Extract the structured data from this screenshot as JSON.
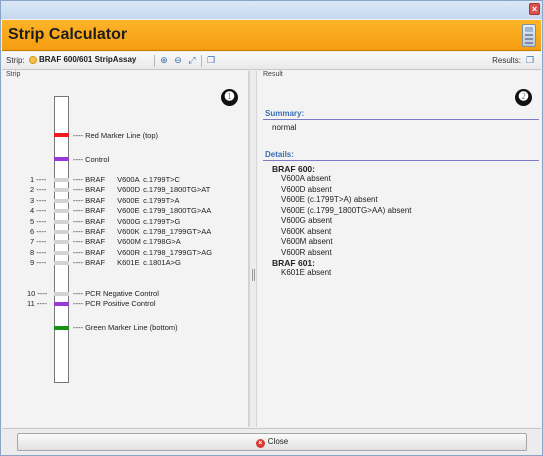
{
  "window": {
    "close_glyph": "×"
  },
  "header": {
    "title": "Strip Calculator",
    "icon": "calculator-icon"
  },
  "toolbar": {
    "strip_label": "Strip:",
    "strip_value": "BRAF 600/601 StripAssay",
    "zoom_in_glyph": "⊕",
    "zoom_out_glyph": "⊖",
    "fit_glyph": "⤢",
    "copy_glyph": "❐",
    "results_label": "Results:",
    "results_copy_glyph": "❐"
  },
  "strip_panel": {
    "heading": "Strip",
    "badge": "➊",
    "markers": [
      {
        "label": "---- Red Marker Line (top)",
        "color": "#ee1c1c"
      },
      {
        "label": "---- Control",
        "color": "#9a38d6"
      }
    ],
    "probes": [
      {
        "num": "1 ----",
        "gene": "BRAF",
        "variant": "V600A",
        "nt": "c.1799T>C"
      },
      {
        "num": "2 ----",
        "gene": "BRAF",
        "variant": "V600D",
        "nt": "c.1799_1800TG>AT"
      },
      {
        "num": "3 ----",
        "gene": "BRAF",
        "variant": "V600E",
        "nt": "c.1799T>A"
      },
      {
        "num": "4 ----",
        "gene": "BRAF",
        "variant": "V600E",
        "nt": "c.1799_1800TG>AA"
      },
      {
        "num": "5 ----",
        "gene": "BRAF",
        "variant": "V600G",
        "nt": "c.1799T>G"
      },
      {
        "num": "6 ----",
        "gene": "BRAF",
        "variant": "V600K",
        "nt": "c.1798_1799GT>AA"
      },
      {
        "num": "7 ----",
        "gene": "BRAF",
        "variant": "V600M",
        "nt": "c.1798G>A"
      },
      {
        "num": "8 ----",
        "gene": "BRAF",
        "variant": "V600R",
        "nt": "c.1798_1799GT>AG"
      },
      {
        "num": "9 ----",
        "gene": "BRAF",
        "variant": "K601E",
        "nt": "c.1801A>G"
      }
    ],
    "pcr": [
      {
        "num": "10 ----",
        "label": "---- PCR Negative Control",
        "color": "#d3d3d3"
      },
      {
        "num": "11 ----",
        "label": "---- PCR Positive Control",
        "color": "#9a38d6"
      }
    ],
    "green_marker": {
      "label": "---- Green Marker Line (bottom)",
      "color": "#1a8f1a"
    },
    "probe_color": "#d3d3d3"
  },
  "result_panel": {
    "heading": "Result",
    "badge": "➋",
    "summary_title": "Summary:",
    "summary_text": "normal",
    "details_title": "Details:",
    "groups": [
      {
        "name": "BRAF 600:",
        "items": [
          "V600A absent",
          "V600D absent",
          "V600E (c.1799T>A) absent",
          "V600E (c.1799_1800TG>AA) absent",
          "V600G absent",
          "V600K absent",
          "V600M absent",
          "V600R absent"
        ]
      },
      {
        "name": "BRAF 601:",
        "items": [
          "K601E absent"
        ]
      }
    ],
    "title_color": "#3b6db3"
  },
  "footer": {
    "close_label": "Close",
    "close_glyph": "×"
  }
}
